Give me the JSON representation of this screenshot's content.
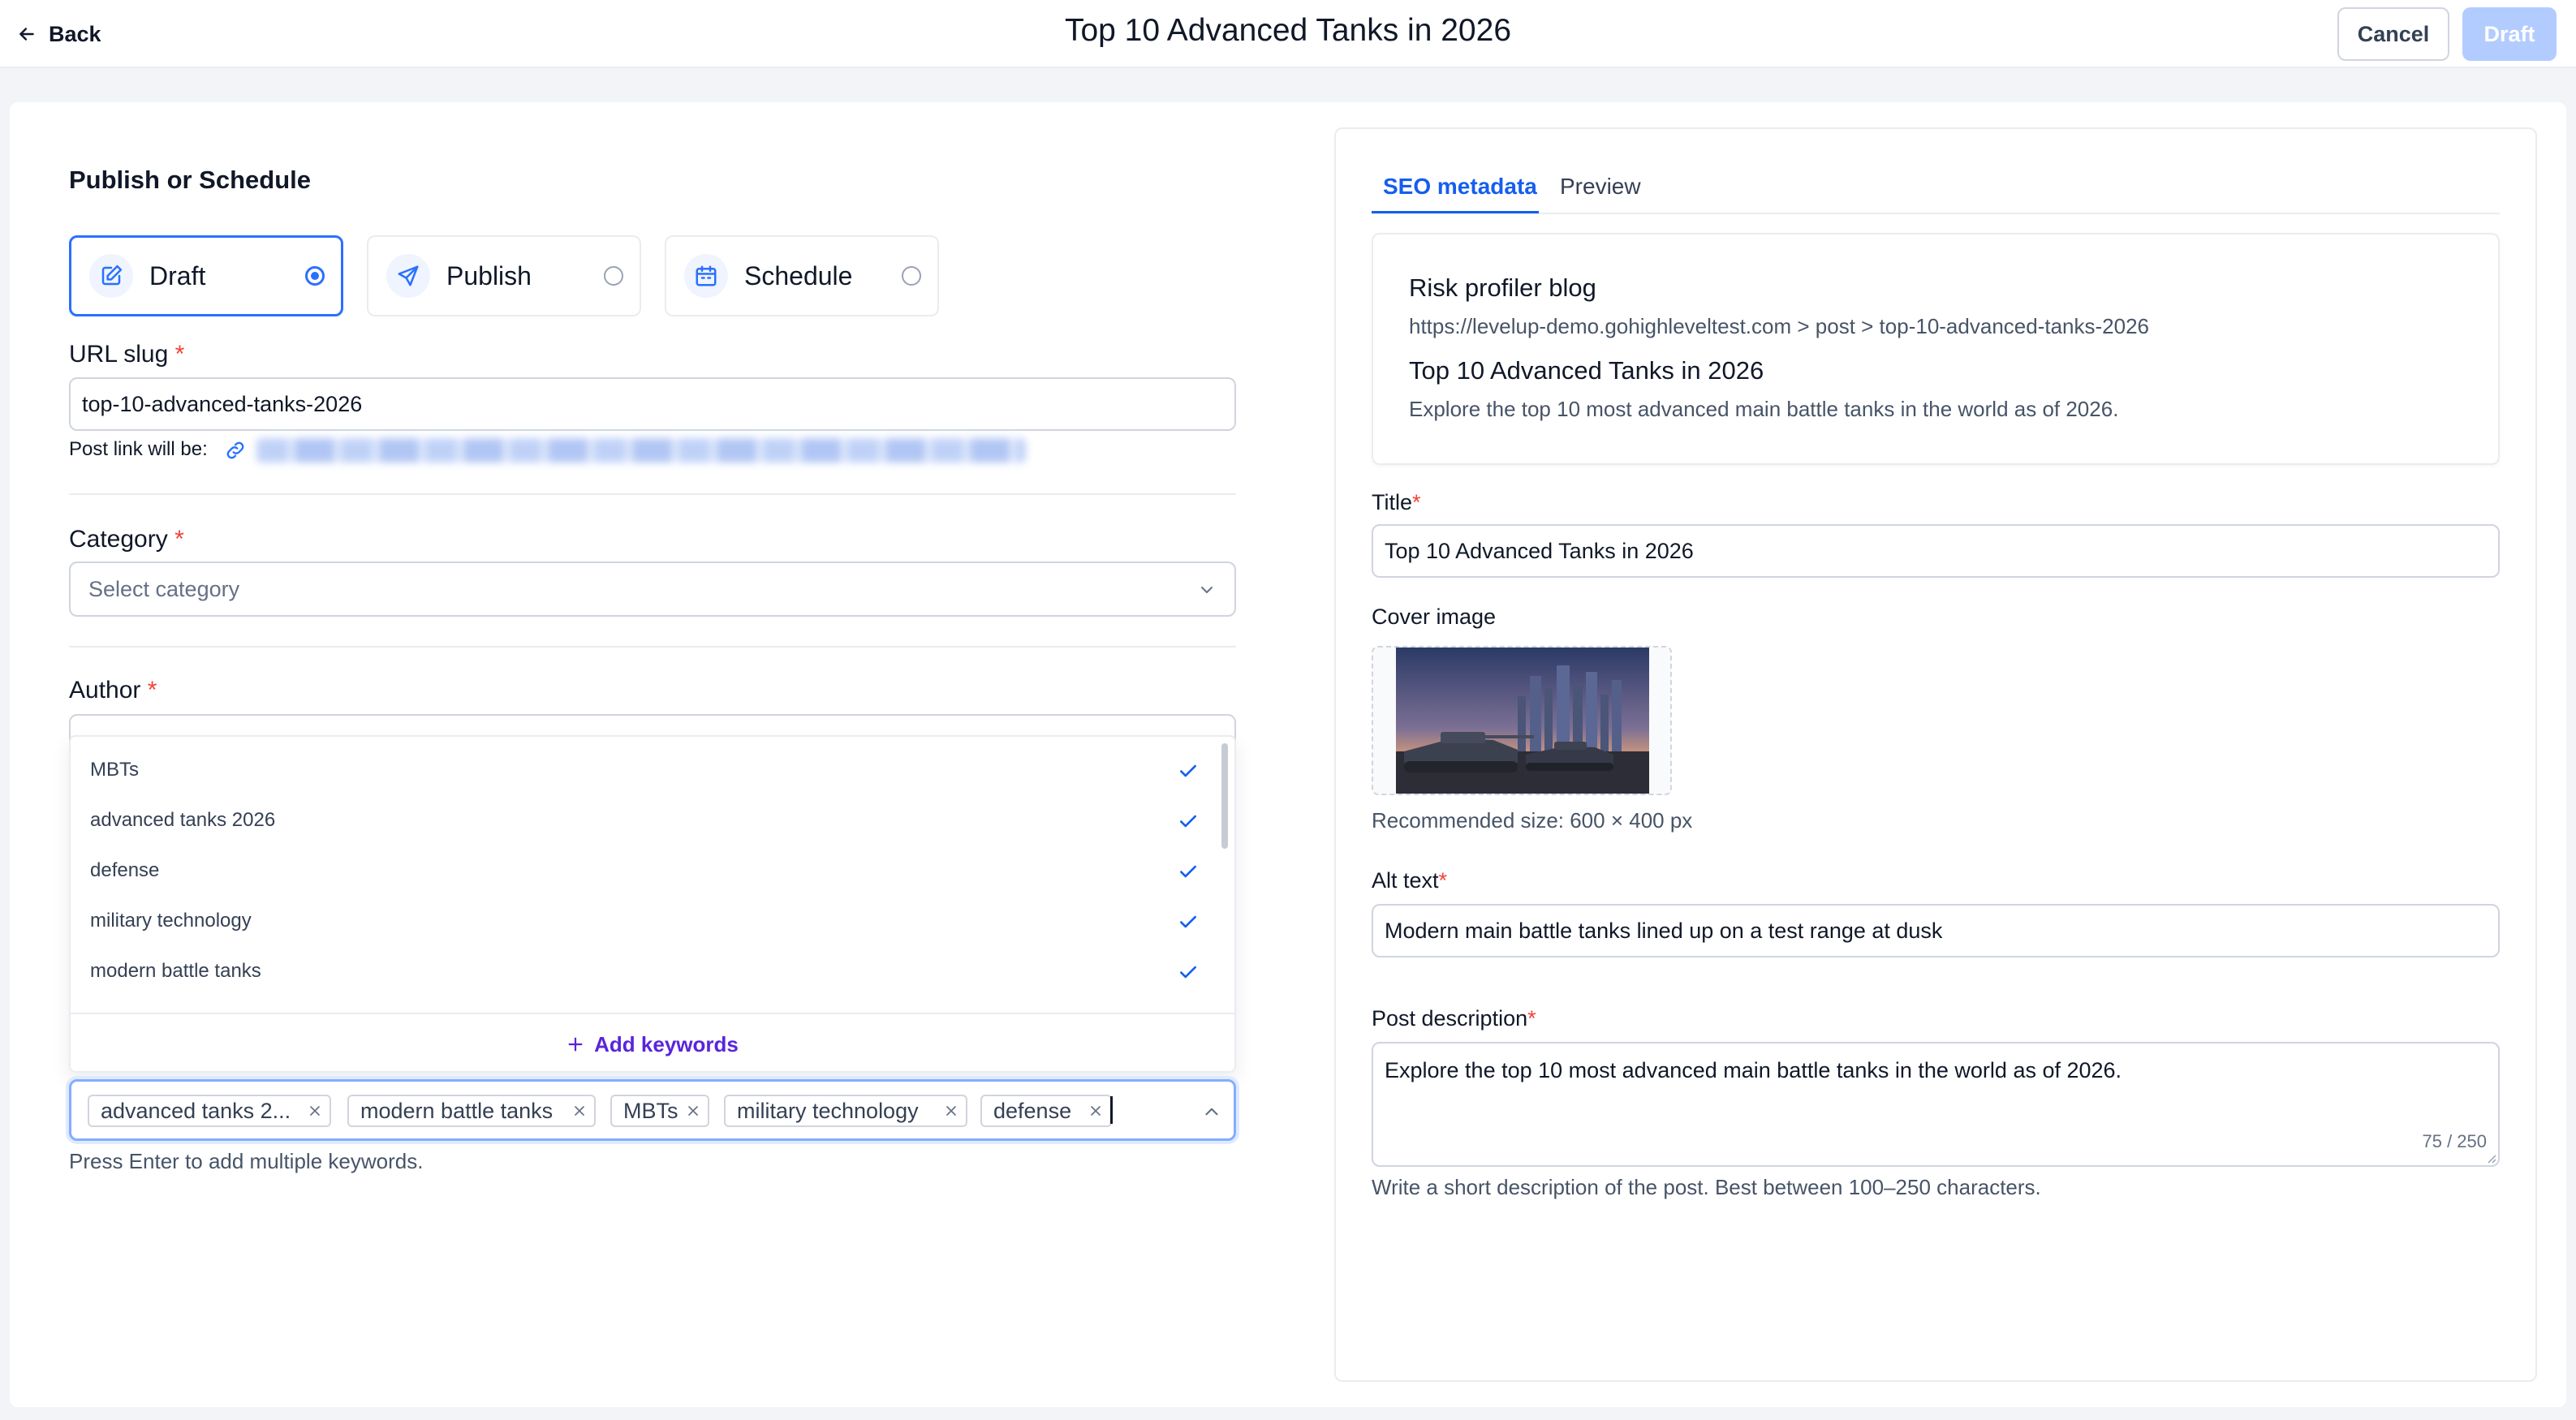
{
  "header": {
    "back_label": "Back",
    "page_title": "Top 10 Advanced Tanks in 2026",
    "cancel_label": "Cancel",
    "draft_label": "Draft"
  },
  "publish": {
    "section_title": "Publish or Schedule",
    "options": [
      {
        "label": "Draft",
        "icon": "edit-icon",
        "selected": true
      },
      {
        "label": "Publish",
        "icon": "send-icon",
        "selected": false
      },
      {
        "label": "Schedule",
        "icon": "calendar-icon",
        "selected": false
      }
    ]
  },
  "url_slug": {
    "label": "URL slug",
    "required_mark": "*",
    "value": "top-10-advanced-tanks-2026",
    "post_link_label": "Post link will be:"
  },
  "category": {
    "label": "Category",
    "required_mark": "*",
    "placeholder": "Select category"
  },
  "author": {
    "label": "Author",
    "required_mark": "*"
  },
  "keywords": {
    "dropdown_items": [
      {
        "label": "MBTs",
        "checked": true
      },
      {
        "label": "advanced tanks 2026",
        "checked": true
      },
      {
        "label": "defense",
        "checked": true
      },
      {
        "label": "military technology",
        "checked": true
      },
      {
        "label": "modern battle tanks",
        "checked": true
      }
    ],
    "add_label": "Add keywords",
    "chips": [
      "advanced tanks 2...",
      "modern battle tanks",
      "MBTs",
      "military technology",
      "defense"
    ],
    "help_text": "Press Enter to add multiple keywords."
  },
  "right_panel": {
    "tabs": [
      {
        "label": "SEO metadata",
        "active": true
      },
      {
        "label": "Preview",
        "active": false
      }
    ],
    "seo_preview": {
      "site_name": "Risk profiler blog",
      "url": "https://levelup-demo.gohighleveltest.com > post > top-10-advanced-tanks-2026",
      "title": "Top 10 Advanced Tanks in 2026",
      "description": "Explore the top 10 most advanced main battle tanks in the world as of 2026."
    },
    "title_field": {
      "label": "Title",
      "required_mark": "*",
      "value": "Top 10 Advanced Tanks in 2026"
    },
    "cover_image": {
      "label": "Cover image",
      "help": "Recommended size: 600 × 400 px"
    },
    "alt_text": {
      "label": "Alt text",
      "required_mark": "*",
      "value": "Modern main battle tanks lined up on a test range at dusk"
    },
    "post_description": {
      "label": "Post description",
      "required_mark": "*",
      "value": "Explore the top 10 most advanced main battle tanks in the world as of 2026.",
      "counter": "75 / 250",
      "help": "Write a short description of the post. Best between 100–250 characters."
    }
  },
  "colors": {
    "primary": "#2970ff",
    "link": "#155eef",
    "accent_purple": "#5925dc",
    "required": "#f04438",
    "draft_button_disabled": "#b2ccff"
  }
}
